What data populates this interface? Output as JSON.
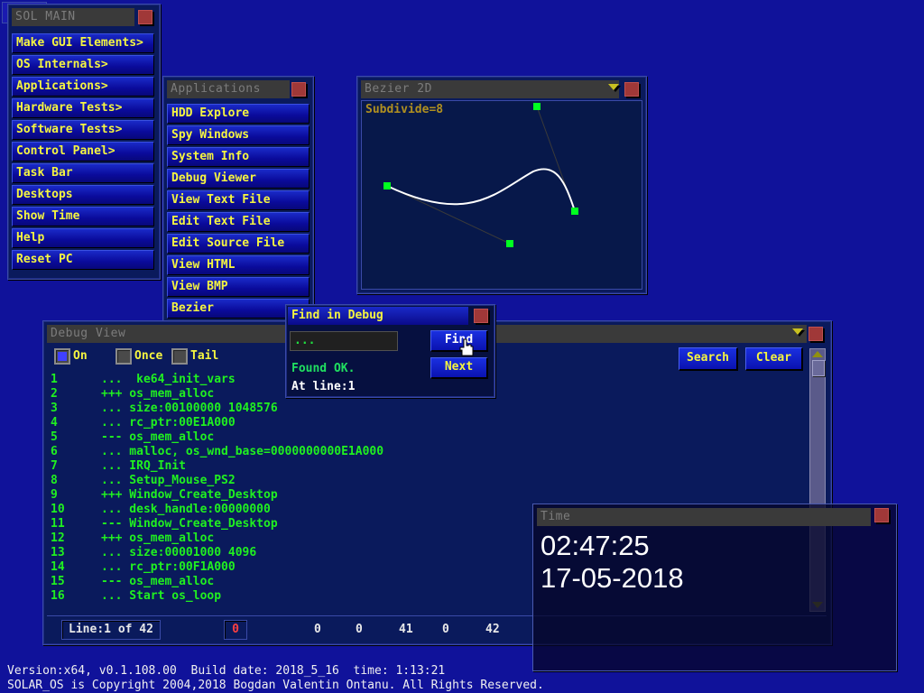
{
  "sol_main": {
    "title": "SOL MAIN",
    "items": [
      {
        "label": "Make GUI Elements>"
      },
      {
        "label": "OS Internals>"
      },
      {
        "label": "Applications>"
      },
      {
        "label": "Hardware Tests>"
      },
      {
        "label": "Software Tests>"
      },
      {
        "label": "Control Panel>"
      },
      {
        "label": "Task Bar"
      },
      {
        "label": "Desktops"
      },
      {
        "label": "Show Time"
      },
      {
        "label": "Help"
      },
      {
        "label": "Reset PC"
      }
    ]
  },
  "applications": {
    "title": "Applications",
    "items": [
      {
        "label": "HDD Explore"
      },
      {
        "label": "Spy Windows"
      },
      {
        "label": "System Info"
      },
      {
        "label": "Debug Viewer"
      },
      {
        "label": "View Text File"
      },
      {
        "label": "Edit Text File"
      },
      {
        "label": "Edit Source File"
      },
      {
        "label": "View HTML"
      },
      {
        "label": "View BMP"
      },
      {
        "label": "Bezier"
      }
    ]
  },
  "bezier": {
    "title": "Bezier 2D",
    "subdivide_label": "Subdivide=8",
    "colors": {
      "curve": "#ffffff",
      "control_point": "#00ff20",
      "control_line": "#3a3a3a",
      "label": "#b09020"
    }
  },
  "find_dialog": {
    "title": "Find in Debug",
    "search_value": "...",
    "find_label": "Find",
    "next_label": "Next",
    "status": "Found OK.",
    "result": "At line:1"
  },
  "debug_view": {
    "title": "Debug View",
    "checkboxes": [
      {
        "label": "On",
        "checked": true
      },
      {
        "label": "Once",
        "checked": false
      },
      {
        "label": "Tail",
        "checked": false
      }
    ],
    "search_label": "Search",
    "clear_label": "Clear",
    "lines": [
      {
        "num": "1",
        "text": "...  ke64_init_vars"
      },
      {
        "num": "2",
        "text": "+++ os_mem_alloc"
      },
      {
        "num": "3",
        "text": "... size:00100000 1048576"
      },
      {
        "num": "4",
        "text": "... rc_ptr:00E1A000"
      },
      {
        "num": "5",
        "text": "--- os_mem_alloc"
      },
      {
        "num": "6",
        "text": "... malloc, os_wnd_base=0000000000E1A000"
      },
      {
        "num": "7",
        "text": "... IRQ_Init"
      },
      {
        "num": "8",
        "text": "... Setup_Mouse_PS2"
      },
      {
        "num": "9",
        "text": "+++ Window_Create_Desktop"
      },
      {
        "num": "10",
        "text": "... desk_handle:00000000"
      },
      {
        "num": "11",
        "text": "--- Window_Create_Desktop"
      },
      {
        "num": "12",
        "text": "+++ os_mem_alloc"
      },
      {
        "num": "13",
        "text": "... size:00001000 4096"
      },
      {
        "num": "14",
        "text": "... rc_ptr:00F1A000"
      },
      {
        "num": "15",
        "text": "--- os_mem_alloc"
      },
      {
        "num": "16",
        "text": "... Start os_loop"
      }
    ],
    "status": {
      "line_info": "Line:1 of 42",
      "error_count": "0",
      "values": [
        "0",
        "0",
        "41",
        "0",
        "42"
      ]
    },
    "scroll_position": 0
  },
  "time_window": {
    "title": "Time",
    "time": "02:47:25",
    "date": "17-05-2018"
  },
  "footer": {
    "version_line": "Version:x64, v0.1.108.00  Build date: 2018_5_16  time: 1:13:21",
    "copyright_line": "SOLAR_OS is Copyright 2004,2018 Bogdan Valentin Ontanu. All Rights Reserved."
  }
}
